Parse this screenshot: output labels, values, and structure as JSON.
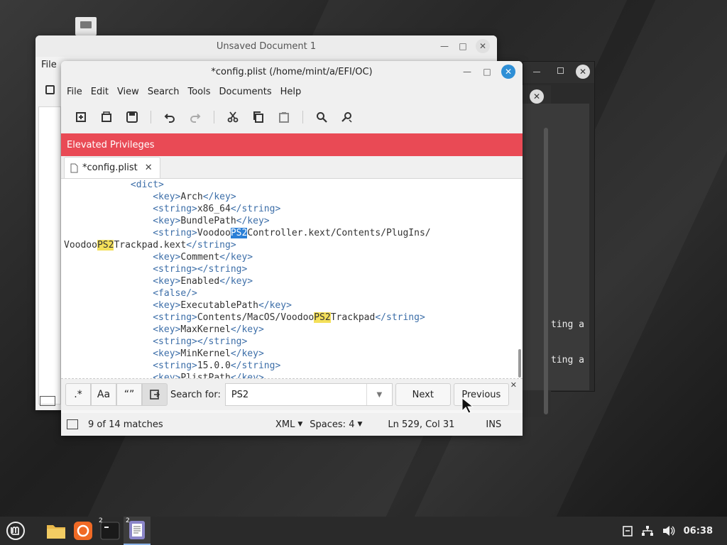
{
  "desktop": {
    "terminal_lines": [
      "ting a",
      "ting a"
    ]
  },
  "unsaved_window": {
    "title": "Unsaved Document 1",
    "menu_first": "File"
  },
  "main_window": {
    "title": "*config.plist (/home/mint/a/EFI/OC)",
    "menu": [
      "File",
      "Edit",
      "View",
      "Search",
      "Tools",
      "Documents",
      "Help"
    ],
    "banner": "Elevated Privileges",
    "tab_label": "*config.plist",
    "code_lines": [
      "            <dict>",
      "                <key>Arch</key>",
      "                <string>x86_64</string>",
      "                <key>BundlePath</key>",
      "                <string>VoodooPS2Controller.kext/Contents/PlugIns/",
      "VoodooPS2Trackpad.kext</string>",
      "                <key>Comment</key>",
      "                <string></string>",
      "                <key>Enabled</key>",
      "                <false/>",
      "                <key>ExecutablePath</key>",
      "                <string>Contents/MacOS/VoodooPS2Trackpad</string>",
      "                <key>MaxKernel</key>",
      "                <string></string>",
      "                <key>MinKernel</key>",
      "                <string>15.0.0</string>",
      "                <key>PlistPath</key>"
    ],
    "search": {
      "regex_label": ".*",
      "case_label": "Aa",
      "quote_label": "“”",
      "search_for_label": "Search for:",
      "query": "PS2",
      "next_label": "Next",
      "previous_label": "Previous"
    },
    "status": {
      "matches": "9 of 14 matches",
      "language": "XML",
      "spaces": "Spaces: 4",
      "position": "Ln 529, Col 31",
      "mode": "INS"
    }
  },
  "taskbar": {
    "terminal_badge": "2",
    "editor_badge": "2",
    "clock": "06:38"
  },
  "colors": {
    "banner": "#e94a55",
    "highlight": "#f4e05a",
    "current_match": "#2b7fd6"
  }
}
